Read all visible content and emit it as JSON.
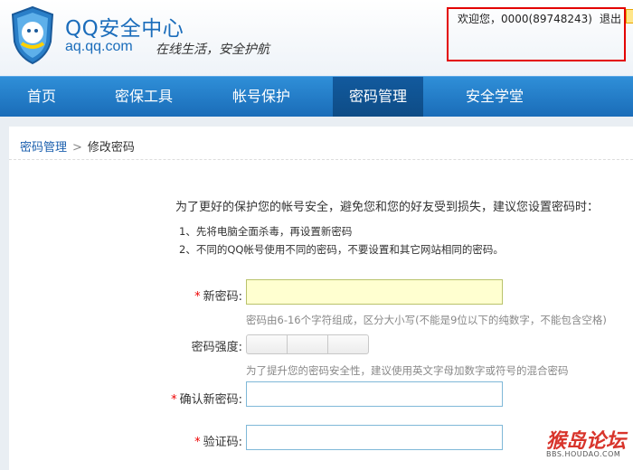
{
  "header": {
    "logo_title": "QQ安全中心",
    "logo_url": "aq.qq.com",
    "slogan": "在线生活，安全护航",
    "welcome": "欢迎您，0000(89748243)",
    "logout": "退出"
  },
  "nav": {
    "items": [
      {
        "label": "首页"
      },
      {
        "label": "密保工具"
      },
      {
        "label": "帐号保护"
      },
      {
        "label": "密码管理",
        "active": true
      },
      {
        "label": "安全学堂"
      }
    ]
  },
  "breadcrumb": {
    "parent": "密码管理",
    "separator": ">",
    "current": "修改密码"
  },
  "form": {
    "intro": "为了更好的保护您的帐号安全，避免您和您的好友受到损失，建议您设置密码时：",
    "tips": [
      "1、先将电脑全面杀毒，再设置新密码",
      "2、不同的QQ帐号使用不同的密码，不要设置和其它网站相同的密码。"
    ],
    "required_mark": "*",
    "new_password": {
      "label": "新密码:",
      "value": "",
      "hint": "密码由6-16个字符组成，区分大小写(不能是9位以下的纯数字，不能包含空格)"
    },
    "strength": {
      "label": "密码强度:",
      "hint": "为了提升您的密码安全性，建议使用英文字母加数字或符号的混合密码"
    },
    "confirm_password": {
      "label": "确认新密码:",
      "value": ""
    },
    "captcha": {
      "label": "验证码:",
      "value": ""
    }
  },
  "watermark": {
    "text": "猴岛论坛",
    "url": "BBS.HOUDAO.COM"
  },
  "colors": {
    "nav_blue": "#1a6cb8",
    "nav_active": "#0e4c86",
    "brand_blue": "#1b6dbb",
    "highlight_red": "#e30000",
    "required_red": "#e00000"
  }
}
